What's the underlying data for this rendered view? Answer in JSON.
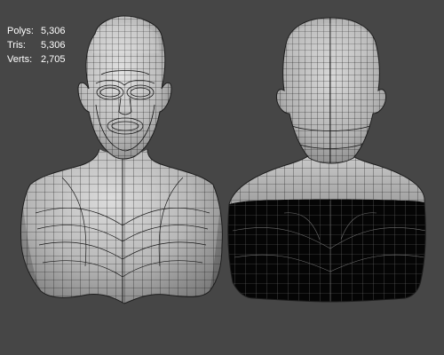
{
  "viewport": {
    "background": "#464646",
    "wire_color": "#111111"
  },
  "stats": {
    "polys": {
      "label": "Polys:",
      "value": "5,306"
    },
    "tris": {
      "label": "Tris:",
      "value": "5,306"
    },
    "verts": {
      "label": "Verts:",
      "value": "2,705"
    }
  },
  "models": {
    "front": {
      "view": "front",
      "icon": "wireframe-bust-front"
    },
    "back": {
      "view": "back",
      "icon": "wireframe-bust-back"
    }
  }
}
